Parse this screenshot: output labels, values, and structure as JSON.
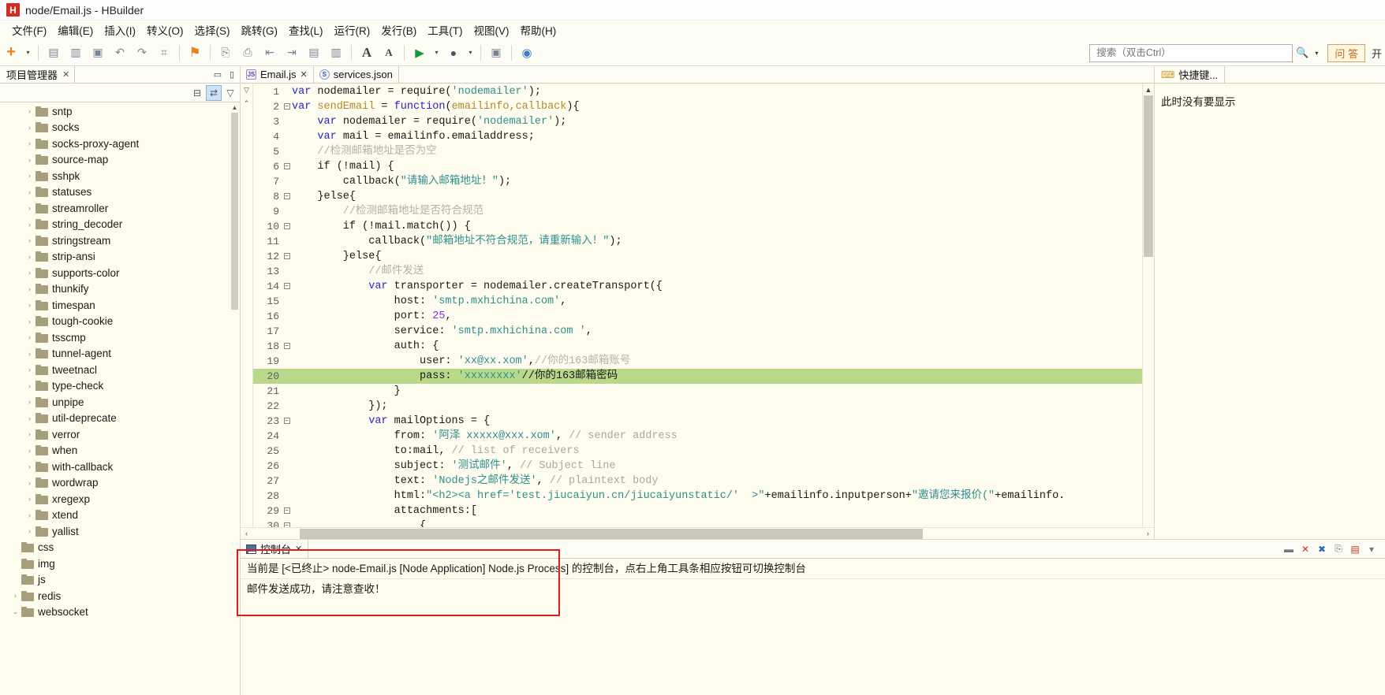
{
  "window": {
    "title": "node/Email.js - HBuilder",
    "app_icon_letter": "H"
  },
  "menubar": [
    {
      "label": "文件(F)"
    },
    {
      "label": "编辑(E)"
    },
    {
      "label": "插入(I)"
    },
    {
      "label": "转义(O)"
    },
    {
      "label": "选择(S)"
    },
    {
      "label": "跳转(G)"
    },
    {
      "label": "查找(L)"
    },
    {
      "label": "运行(R)"
    },
    {
      "label": "发行(B)"
    },
    {
      "label": "工具(T)"
    },
    {
      "label": "视图(V)"
    },
    {
      "label": "帮助(H)"
    }
  ],
  "toolbar": {
    "icons": [
      {
        "name": "new-plus-icon",
        "glyph": "+"
      },
      {
        "name": "new-dropdown-caret-icon",
        "glyph": "▾"
      },
      {
        "name": "save-icon",
        "glyph": "▤"
      },
      {
        "name": "save-all-icon",
        "glyph": "▥"
      },
      {
        "name": "close-file-icon",
        "glyph": "▣"
      },
      {
        "name": "undo-icon",
        "glyph": "↶"
      },
      {
        "name": "redo-icon",
        "glyph": "↷"
      },
      {
        "name": "format-icon",
        "glyph": "⌗"
      },
      {
        "name": "bookmark-icon",
        "glyph": "⚑"
      },
      {
        "name": "previous-edit-icon",
        "glyph": "⎘"
      },
      {
        "name": "next-edit-icon",
        "glyph": "⎙"
      },
      {
        "name": "indent-left-icon",
        "glyph": "⇤"
      },
      {
        "name": "indent-right-icon",
        "glyph": "⇥"
      },
      {
        "name": "comment-icon",
        "glyph": "▤"
      },
      {
        "name": "uncomment-icon",
        "glyph": "▥"
      },
      {
        "name": "increase-font-icon",
        "glyph": "A"
      },
      {
        "name": "decrease-font-icon",
        "glyph": "A"
      },
      {
        "name": "run-icon",
        "glyph": "▶"
      },
      {
        "name": "run-dropdown-caret-icon",
        "glyph": "▾"
      },
      {
        "name": "debug-icon",
        "glyph": "●"
      },
      {
        "name": "debug-dropdown-caret-icon",
        "glyph": "▾"
      },
      {
        "name": "preview-icon",
        "glyph": "▣"
      },
      {
        "name": "browser-icon",
        "glyph": "◉"
      }
    ],
    "search_placeholder": "搜索（双击Ctrl）",
    "search_value": "",
    "search_icon": "search-icon",
    "search_caret": "▾",
    "ask_label": "问 答",
    "open_label": "开"
  },
  "project_panel": {
    "tab_label": "项目管理器",
    "tab_close": "✕",
    "minimize": "▭",
    "maximize": "▯",
    "tools": [
      {
        "name": "collapse-all-icon",
        "glyph": "⊟"
      },
      {
        "name": "link-with-editor-icon",
        "glyph": "⇄"
      },
      {
        "name": "view-menu-icon",
        "glyph": "▽"
      }
    ],
    "tree": [
      {
        "label": "sntp",
        "indent": 1,
        "expandable": true
      },
      {
        "label": "socks",
        "indent": 1,
        "expandable": true
      },
      {
        "label": "socks-proxy-agent",
        "indent": 1,
        "expandable": true
      },
      {
        "label": "source-map",
        "indent": 1,
        "expandable": true
      },
      {
        "label": "sshpk",
        "indent": 1,
        "expandable": true
      },
      {
        "label": "statuses",
        "indent": 1,
        "expandable": true
      },
      {
        "label": "streamroller",
        "indent": 1,
        "expandable": true
      },
      {
        "label": "string_decoder",
        "indent": 1,
        "expandable": true
      },
      {
        "label": "stringstream",
        "indent": 1,
        "expandable": true
      },
      {
        "label": "strip-ansi",
        "indent": 1,
        "expandable": true
      },
      {
        "label": "supports-color",
        "indent": 1,
        "expandable": true
      },
      {
        "label": "thunkify",
        "indent": 1,
        "expandable": true
      },
      {
        "label": "timespan",
        "indent": 1,
        "expandable": true
      },
      {
        "label": "tough-cookie",
        "indent": 1,
        "expandable": true
      },
      {
        "label": "tsscmp",
        "indent": 1,
        "expandable": true
      },
      {
        "label": "tunnel-agent",
        "indent": 1,
        "expandable": true
      },
      {
        "label": "tweetnacl",
        "indent": 1,
        "expandable": true
      },
      {
        "label": "type-check",
        "indent": 1,
        "expandable": true
      },
      {
        "label": "unpipe",
        "indent": 1,
        "expandable": true
      },
      {
        "label": "util-deprecate",
        "indent": 1,
        "expandable": true
      },
      {
        "label": "verror",
        "indent": 1,
        "expandable": true
      },
      {
        "label": "when",
        "indent": 1,
        "expandable": true
      },
      {
        "label": "with-callback",
        "indent": 1,
        "expandable": true
      },
      {
        "label": "wordwrap",
        "indent": 1,
        "expandable": true
      },
      {
        "label": "xregexp",
        "indent": 1,
        "expandable": true
      },
      {
        "label": "xtend",
        "indent": 1,
        "expandable": true
      },
      {
        "label": "yallist",
        "indent": 1,
        "expandable": true
      },
      {
        "label": "css",
        "indent": 0,
        "expandable": false
      },
      {
        "label": "img",
        "indent": 0,
        "expandable": false
      },
      {
        "label": "js",
        "indent": 0,
        "expandable": false
      },
      {
        "label": "redis",
        "indent": 0,
        "expandable": true
      },
      {
        "label": "websocket",
        "indent": 0,
        "expandable": true,
        "expanded": true
      }
    ]
  },
  "editor": {
    "tabs": [
      {
        "label": "Email.js",
        "icon": "js-file-icon",
        "active": true,
        "closable": true
      },
      {
        "label": "services.json",
        "icon": "json-file-icon",
        "active": false,
        "closable": false
      }
    ],
    "lines": [
      {
        "n": 1,
        "fold": "",
        "segs": [
          {
            "t": "var ",
            "c": "kw"
          },
          {
            "t": "nodemailer = require(",
            "c": ""
          },
          {
            "t": "'nodemailer'",
            "c": "str"
          },
          {
            "t": ");",
            "c": ""
          }
        ]
      },
      {
        "n": 2,
        "fold": "-",
        "segs": [
          {
            "t": "var ",
            "c": "kw"
          },
          {
            "t": "sendEmail",
            "c": "fn"
          },
          {
            "t": " = ",
            "c": ""
          },
          {
            "t": "function",
            "c": "kw"
          },
          {
            "t": "(",
            "c": ""
          },
          {
            "t": "emailinfo,callback",
            "c": "fn"
          },
          {
            "t": "){",
            "c": ""
          }
        ]
      },
      {
        "n": 3,
        "fold": "",
        "segs": [
          {
            "t": "    var ",
            "c": "kw"
          },
          {
            "t": "nodemailer = require(",
            "c": ""
          },
          {
            "t": "'nodemailer'",
            "c": "str"
          },
          {
            "t": ");",
            "c": ""
          }
        ]
      },
      {
        "n": 4,
        "fold": "",
        "segs": [
          {
            "t": "    var ",
            "c": "kw"
          },
          {
            "t": "mail = emailinfo.emailaddress;",
            "c": ""
          }
        ]
      },
      {
        "n": 5,
        "fold": "",
        "segs": [
          {
            "t": "    //检测邮箱地址是否为空",
            "c": "cmt-cn"
          }
        ]
      },
      {
        "n": 6,
        "fold": "-",
        "segs": [
          {
            "t": "    if (!mail) {",
            "c": ""
          }
        ]
      },
      {
        "n": 7,
        "fold": "",
        "segs": [
          {
            "t": "        callback(",
            "c": ""
          },
          {
            "t": "\"请输入邮箱地址！\"",
            "c": "str"
          },
          {
            "t": ");",
            "c": ""
          }
        ]
      },
      {
        "n": 8,
        "fold": "-",
        "segs": [
          {
            "t": "    }else{",
            "c": ""
          }
        ]
      },
      {
        "n": 9,
        "fold": "",
        "segs": [
          {
            "t": "        //检测邮箱地址是否符合规范",
            "c": "cmt-cn"
          }
        ]
      },
      {
        "n": 10,
        "fold": "-",
        "segs": [
          {
            "t": "        if (!mail.match()) {",
            "c": ""
          }
        ]
      },
      {
        "n": 11,
        "fold": "",
        "segs": [
          {
            "t": "            callback(",
            "c": ""
          },
          {
            "t": "\"邮箱地址不符合规范，请重新输入！\"",
            "c": "str"
          },
          {
            "t": ");",
            "c": ""
          }
        ]
      },
      {
        "n": 12,
        "fold": "-",
        "segs": [
          {
            "t": "        }else{",
            "c": ""
          }
        ]
      },
      {
        "n": 13,
        "fold": "",
        "segs": [
          {
            "t": "            //邮件发送",
            "c": "cmt-cn"
          }
        ]
      },
      {
        "n": 14,
        "fold": "-",
        "segs": [
          {
            "t": "            ",
            "c": ""
          },
          {
            "t": "var ",
            "c": "kw"
          },
          {
            "t": "transporter = nodemailer.createTransport({",
            "c": ""
          }
        ]
      },
      {
        "n": 15,
        "fold": "",
        "segs": [
          {
            "t": "                host: ",
            "c": ""
          },
          {
            "t": "'smtp.mxhichina.com'",
            "c": "str"
          },
          {
            "t": ",",
            "c": ""
          }
        ]
      },
      {
        "n": 16,
        "fold": "",
        "segs": [
          {
            "t": "                port: ",
            "c": ""
          },
          {
            "t": "25",
            "c": "num"
          },
          {
            "t": ",",
            "c": ""
          }
        ]
      },
      {
        "n": 17,
        "fold": "",
        "segs": [
          {
            "t": "                service: ",
            "c": ""
          },
          {
            "t": "'smtp.mxhichina.com '",
            "c": "str"
          },
          {
            "t": ",",
            "c": ""
          }
        ]
      },
      {
        "n": 18,
        "fold": "-",
        "segs": [
          {
            "t": "                auth: {",
            "c": ""
          }
        ]
      },
      {
        "n": 19,
        "fold": "",
        "segs": [
          {
            "t": "                    user: ",
            "c": ""
          },
          {
            "t": "'xx@xx.xom'",
            "c": "str"
          },
          {
            "t": ",",
            "c": ""
          },
          {
            "t": "//你的163邮箱账号",
            "c": "cmt-cn"
          }
        ]
      },
      {
        "n": 20,
        "fold": "",
        "hl": true,
        "segs": [
          {
            "t": "                    pass: ",
            "c": ""
          },
          {
            "t": "'xxxxxxxx'",
            "c": "str"
          },
          {
            "t": "//你的163邮箱密码",
            "c": ""
          }
        ]
      },
      {
        "n": 21,
        "fold": "",
        "segs": [
          {
            "t": "                }",
            "c": ""
          }
        ]
      },
      {
        "n": 22,
        "fold": "",
        "segs": [
          {
            "t": "            });",
            "c": ""
          }
        ]
      },
      {
        "n": 23,
        "fold": "-",
        "segs": [
          {
            "t": "            ",
            "c": ""
          },
          {
            "t": "var ",
            "c": "kw"
          },
          {
            "t": "mailOptions = {",
            "c": ""
          }
        ]
      },
      {
        "n": 24,
        "fold": "",
        "segs": [
          {
            "t": "                from: ",
            "c": ""
          },
          {
            "t": "'阿泽 xxxxx@xxx.xom'",
            "c": "str"
          },
          {
            "t": ", ",
            "c": ""
          },
          {
            "t": "// sender address",
            "c": "cmt"
          }
        ]
      },
      {
        "n": 25,
        "fold": "",
        "segs": [
          {
            "t": "                to:mail, ",
            "c": ""
          },
          {
            "t": "// list of receivers",
            "c": "cmt"
          }
        ]
      },
      {
        "n": 26,
        "fold": "",
        "segs": [
          {
            "t": "                subject: ",
            "c": ""
          },
          {
            "t": "'测试邮件'",
            "c": "str"
          },
          {
            "t": ", ",
            "c": ""
          },
          {
            "t": "// Subject line",
            "c": "cmt"
          }
        ]
      },
      {
        "n": 27,
        "fold": "",
        "segs": [
          {
            "t": "                text: ",
            "c": ""
          },
          {
            "t": "'Nodejs之邮件发送'",
            "c": "str"
          },
          {
            "t": ", ",
            "c": ""
          },
          {
            "t": "// plaintext body",
            "c": "cmt"
          }
        ]
      },
      {
        "n": 28,
        "fold": "",
        "segs": [
          {
            "t": "                html:",
            "c": ""
          },
          {
            "t": "\"<h2><a href='test.jiucaiyun.cn/jiucaiyunstatic/'  >\"",
            "c": "str"
          },
          {
            "t": "+emailinfo.inputperson+",
            "c": ""
          },
          {
            "t": "\"邀请您来报价(\"",
            "c": "str"
          },
          {
            "t": "+emailinfo.",
            "c": ""
          }
        ]
      },
      {
        "n": 29,
        "fold": "-",
        "segs": [
          {
            "t": "                attachments:[",
            "c": ""
          }
        ]
      },
      {
        "n": 30,
        "fold": "-",
        "segs": [
          {
            "t": "                    {",
            "c": ""
          }
        ]
      }
    ],
    "hscroll": {
      "left_arrow": "‹",
      "right_arrow": "›"
    },
    "vscroll": {
      "up_arrow": "▲",
      "down_arrow": "▼"
    }
  },
  "outline": {
    "tab_label": "快捷键...",
    "icon": "key-icon",
    "empty_message": "此时没有要显示"
  },
  "console": {
    "tab_label": "控制台",
    "tab_close": "✕",
    "icon": "console-icon",
    "lines": [
      "当前是 [<已终止> node-Email.js [Node Application] Node.js Process] 的控制台，点右上角工具条相应按钮可切换控制台",
      "邮件发送成功，请注意查收！"
    ],
    "tool_icons": [
      {
        "name": "terminate-icon",
        "glyph": "▬"
      },
      {
        "name": "remove-launch-icon",
        "glyph": "✕"
      },
      {
        "name": "remove-all-terminated-icon",
        "glyph": "✖"
      },
      {
        "name": "scroll-lock-icon",
        "glyph": "⎘"
      },
      {
        "name": "pin-console-icon",
        "glyph": "▤"
      },
      {
        "name": "display-selected-console-icon",
        "glyph": "▾"
      }
    ]
  },
  "colors": {
    "highlight_line": "#b8d98a",
    "annotation_box": "#e01b1b",
    "accent_orange": "#e8821a",
    "editor_bg": "#fdfcee"
  }
}
